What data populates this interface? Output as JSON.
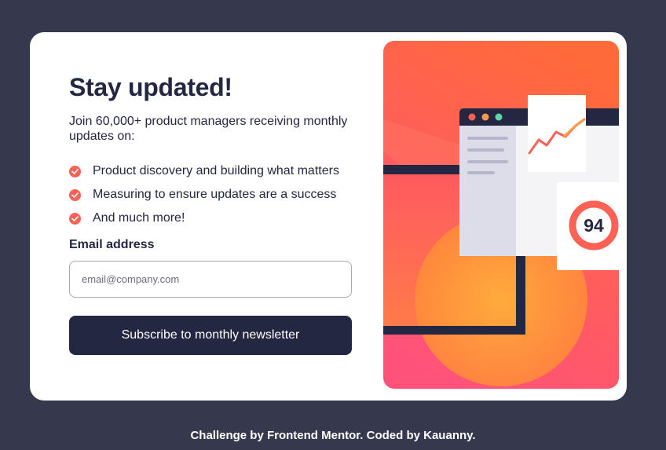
{
  "main": {
    "title": "Stay updated!",
    "intro": "Join 60,000+ product managers receiving monthly updates on:",
    "features": [
      "Product discovery and building what matters",
      "Measuring to ensure updates are a success",
      "And much more!"
    ],
    "email_label": "Email address",
    "email_placeholder": "email@company.com",
    "email_value": "",
    "subscribe_label": "Subscribe to monthly newsletter"
  },
  "illustration": {
    "score": "94",
    "icons": [
      "check-icon",
      "line-chart-icon",
      "score-ring-icon"
    ]
  },
  "footer": {
    "credit": "Challenge by Frontend Mentor. Coded by Kauanny."
  },
  "colors": {
    "background": "#36384e",
    "card": "#ffffff",
    "text": "#242742",
    "accent": "#ff6155",
    "button": "#242742",
    "gradient_top": "#ff6a3a",
    "gradient_bottom": "#ff527b"
  }
}
